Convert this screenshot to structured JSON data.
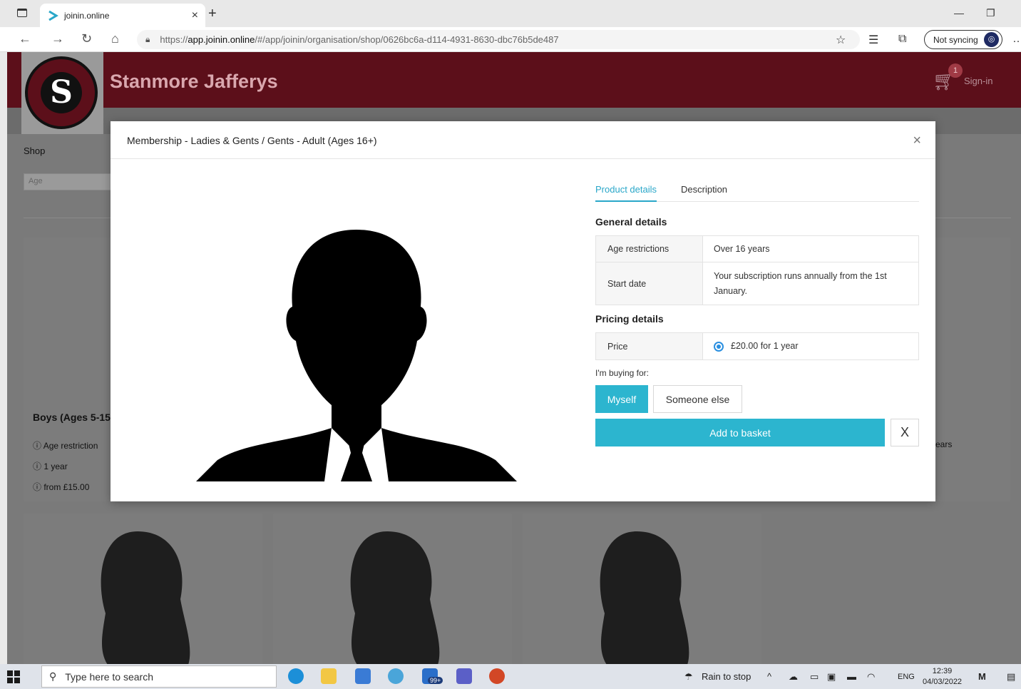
{
  "browser": {
    "tab_title": "joinin.online",
    "tab_close": "×",
    "new_tab": "+",
    "url_prefix": "https://",
    "url_host": "app.joinin.online",
    "url_path": "/#/app/joinin/organisation/shop/0626bc6a-d114-4931-8630-dbc76b5de487",
    "sync_label": "Not syncing"
  },
  "site": {
    "brand": "Stanmore Jafferys",
    "cart_count": "1",
    "signin": "Sign-in",
    "shop_label": "Shop",
    "age_filter_placeholder": "Age"
  },
  "background_card": {
    "title": "Boys (Ages 5-15",
    "lines": [
      "Age restriction",
      "1 year",
      "from £15.00"
    ],
    "right_fragment": "ears"
  },
  "modal": {
    "title": "Membership - Ladies & Gents / Gents - Adult (Ages 16+)",
    "close": "×",
    "tabs": [
      "Product details",
      "Description"
    ],
    "general_heading": "General details",
    "general_rows": [
      {
        "key": "Age restrictions",
        "value": "Over 16 years"
      },
      {
        "key": "Start date",
        "value": "Your subscription runs annually from the 1st January."
      }
    ],
    "pricing_heading": "Pricing details",
    "pricing_rows": [
      {
        "key": "Price",
        "value": "£20.00 for 1 year"
      }
    ],
    "buying_for_label": "I'm buying for:",
    "btn_myself": "Myself",
    "btn_someone_else": "Someone else",
    "btn_add_basket": "Add to basket",
    "btn_cancel": "X"
  },
  "taskbar": {
    "search_placeholder": "Type here to search",
    "weather": "Rain to stop",
    "lang": "ENG",
    "time": "12:39",
    "date": "04/03/2022",
    "teams_badge": "99+"
  },
  "colors": {
    "brand_maroon": "#5c0f1a",
    "accent_teal": "#2cb5cf",
    "tab_active": "#2aa7c9"
  }
}
